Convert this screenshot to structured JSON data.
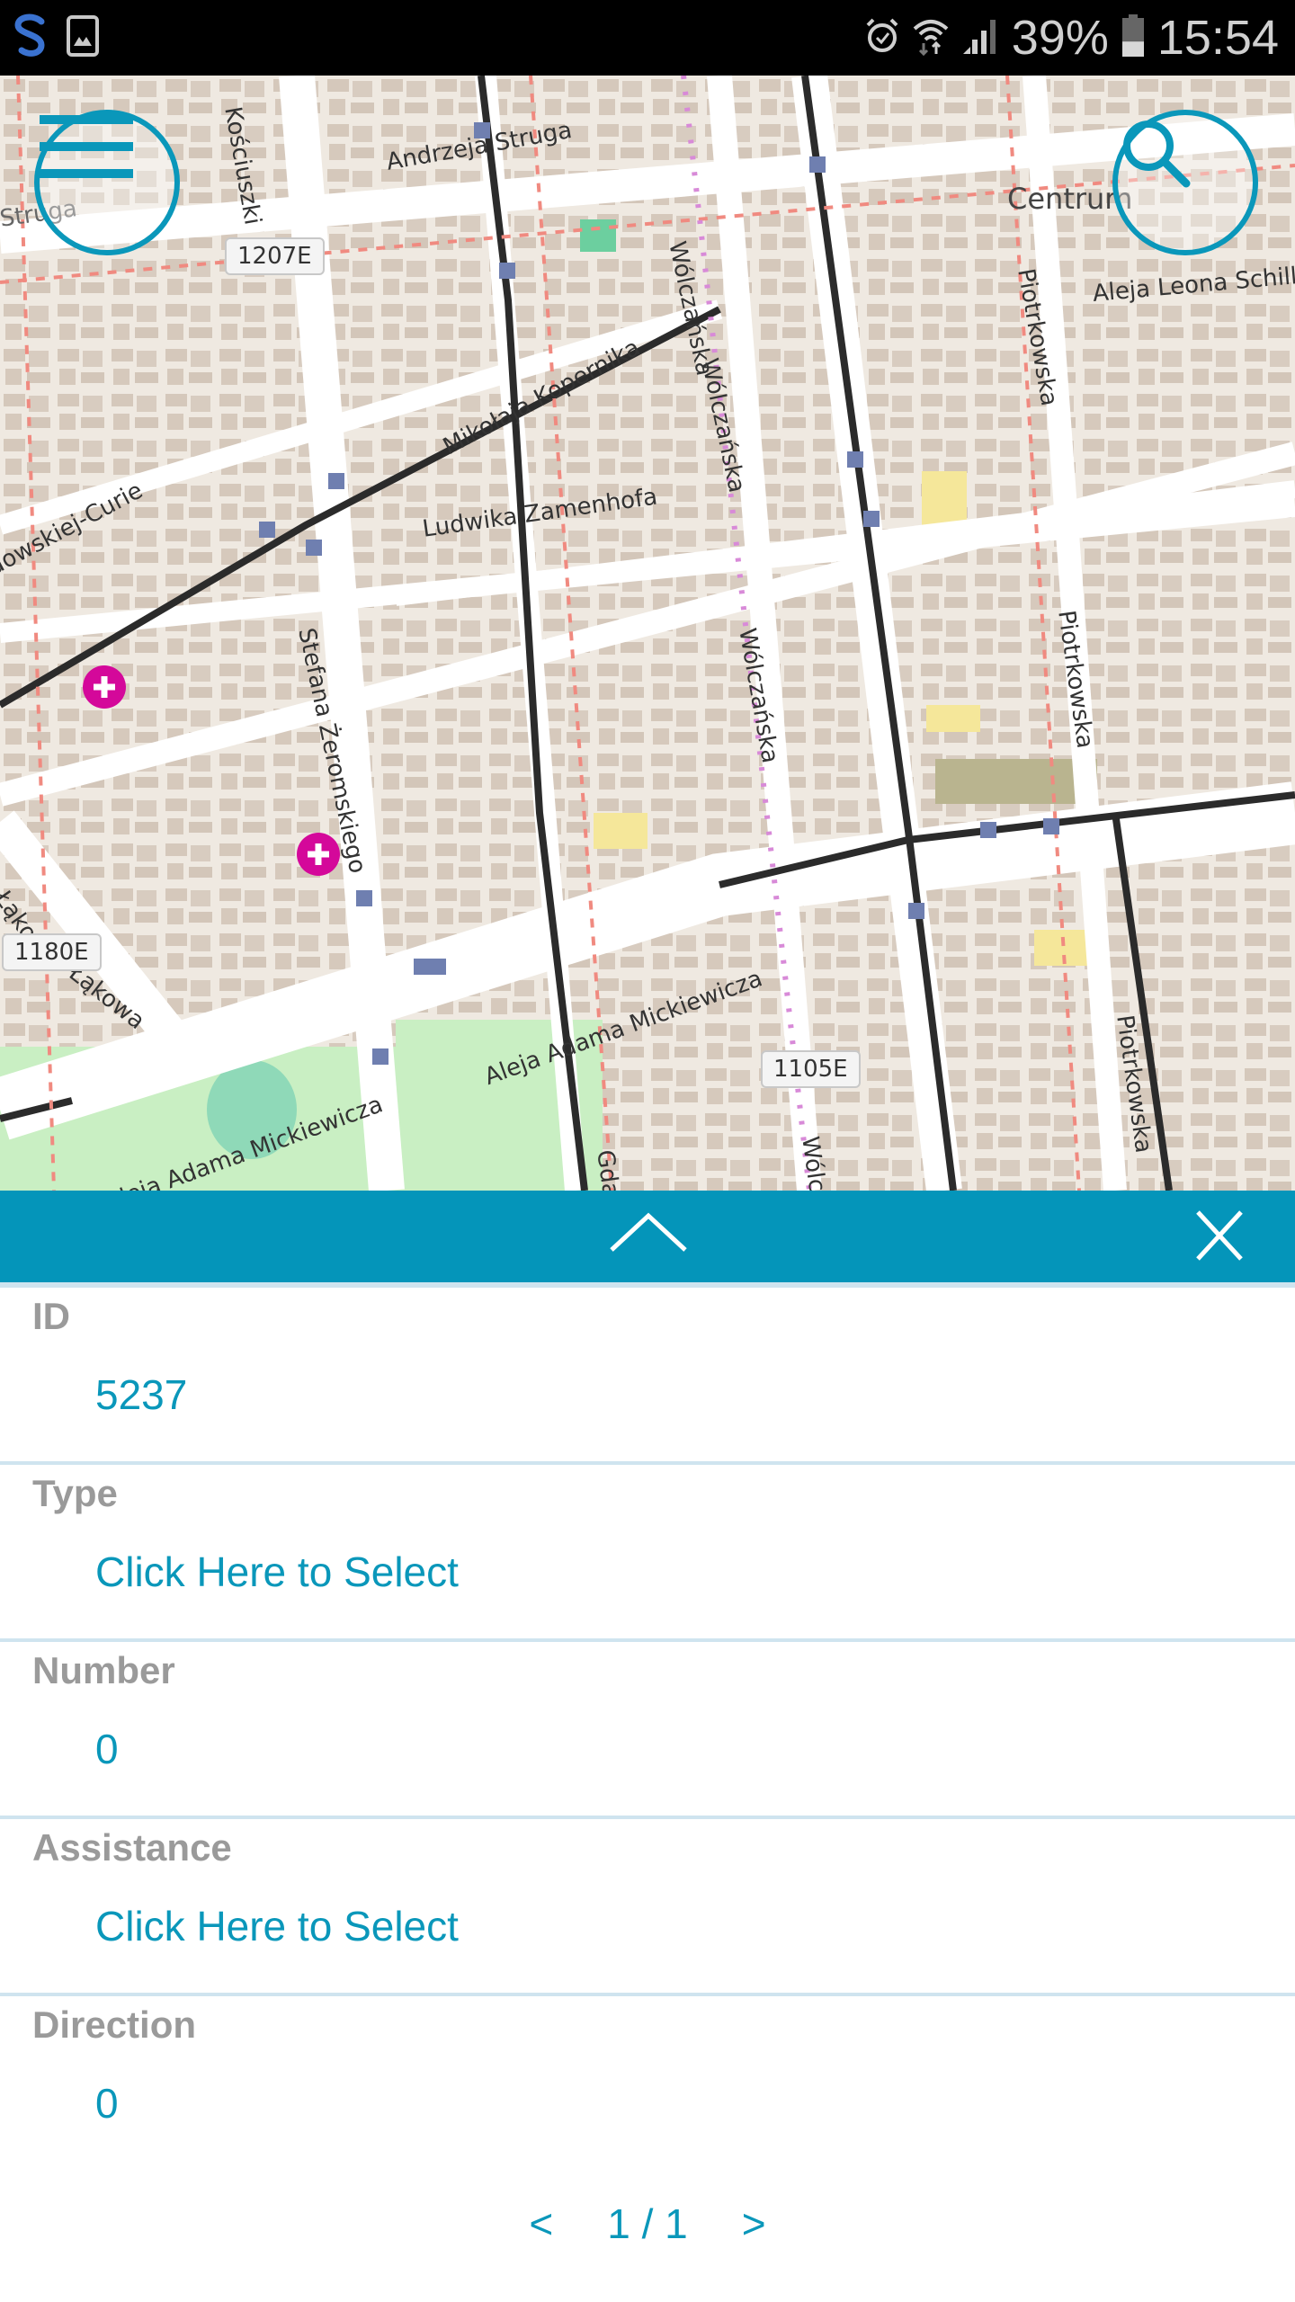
{
  "status_bar": {
    "left_icons": [
      "samsung-s-icon",
      "gallery-icon"
    ],
    "right_icons": [
      "alarm-icon",
      "wifi-icon",
      "signal-icon"
    ],
    "battery_percent": "39%",
    "battery_level": 0.39,
    "time": "15:54"
  },
  "map": {
    "street_labels": [
      "Andrzeja Struga",
      "Struga",
      "Mikołaja Kopernika",
      "Ludwika Zamenhofa",
      "Stefana Żeromskiego",
      "Wólczańska",
      "Wólczańska",
      "Wólczańska",
      "Wólcza",
      "Piotrkowska",
      "Piotrkowska",
      "Piotrkowska",
      "Aleja Leona Schill",
      "Centrum",
      "Aleja Adama Mickiewicza",
      "Aleja Adama Mickiewicza",
      "Łąkowa",
      "Łąkowa",
      "Skłodowskiej-Curie",
      "Gdańska",
      "Kościuszki"
    ],
    "road_shields": [
      "1207E",
      "1180E",
      "1105E"
    ],
    "menu_button": "menu-icon",
    "search_button": "search-icon"
  },
  "panel": {
    "header": {
      "expand_icon": "chevron-up-icon",
      "close_icon": "close-icon"
    },
    "fields": [
      {
        "label": "ID",
        "value": "5237"
      },
      {
        "label": "Type",
        "value": "Click Here to Select"
      },
      {
        "label": "Number",
        "value": "0"
      },
      {
        "label": "Assistance",
        "value": "Click Here to Select"
      },
      {
        "label": "Direction",
        "value": "0"
      }
    ],
    "pager": {
      "prev": "<",
      "current": "1 / 1",
      "next": ">"
    }
  },
  "colors": {
    "accent": "#0495ba",
    "label_gray": "#9a9a9a",
    "divider": "#cfe4ef"
  }
}
